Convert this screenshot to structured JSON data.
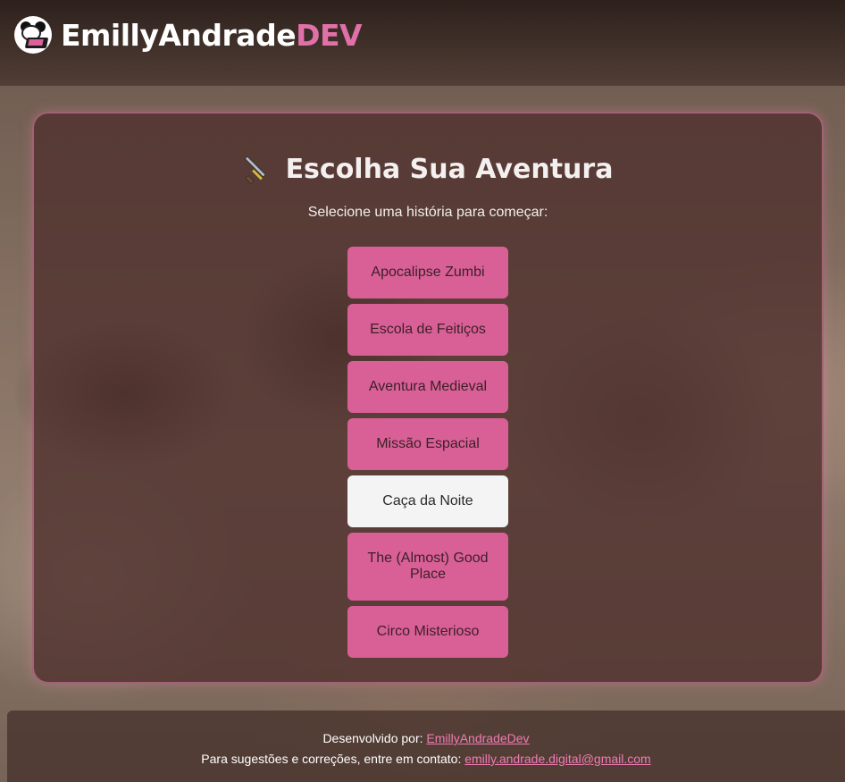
{
  "header": {
    "logo_icon": "panda-laptop-icon",
    "brand_main": "EmillyAndrade",
    "brand_accent": "DEV",
    "accent_color": "#e070a8"
  },
  "main": {
    "title_icon": "sword-icon",
    "title": "Escolha Sua Aventura",
    "subtitle": "Selecione uma história para começar:",
    "stories": [
      {
        "label": "Apocalipse Zumbi",
        "selected": false
      },
      {
        "label": "Escola de Feitiços",
        "selected": false
      },
      {
        "label": "Aventura Medieval",
        "selected": false
      },
      {
        "label": "Missão Espacial",
        "selected": false
      },
      {
        "label": "Caça da Noite",
        "selected": true
      },
      {
        "label": "The (Almost) Good Place",
        "selected": false
      },
      {
        "label": "Circo Misterioso",
        "selected": false
      }
    ],
    "button_color": "#d96096",
    "selected_button_color": "#f4f4f4"
  },
  "footer": {
    "developed_by_label": "Desenvolvido por:",
    "developer_link": "EmillyAndradeDev",
    "contact_label": "Para sugestões e correções, entre em contato:",
    "contact_email": "emilly.andrade.digital@gmail.com"
  }
}
